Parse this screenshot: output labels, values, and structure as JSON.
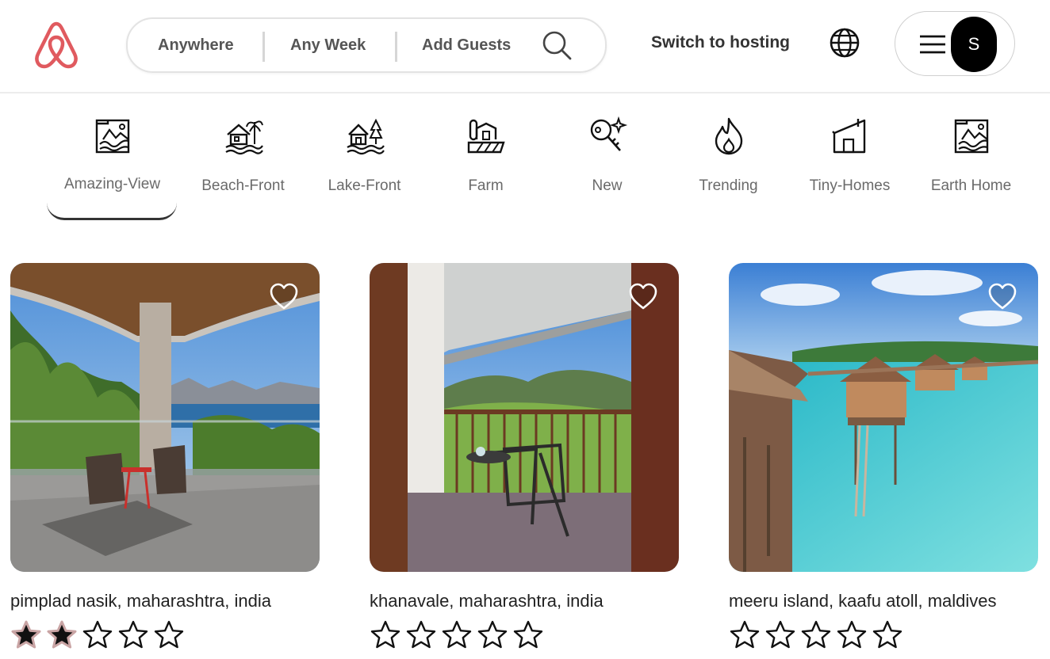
{
  "search": {
    "anywhere": "Anywhere",
    "any_week": "Any Week",
    "add_guests": "Add Guests"
  },
  "header": {
    "switch_to_hosting": "Switch to hosting",
    "avatar_initial": "S",
    "brand_color": "#e05a5f"
  },
  "categories": [
    {
      "label": "Amazing-View",
      "icon": "amazing-view-icon",
      "active": true
    },
    {
      "label": "Beach-Front",
      "icon": "beach-front-icon"
    },
    {
      "label": "Lake-Front",
      "icon": "lake-front-icon"
    },
    {
      "label": "Farm",
      "icon": "farm-icon"
    },
    {
      "label": "New",
      "icon": "new-icon"
    },
    {
      "label": "Trending",
      "icon": "trending-icon"
    },
    {
      "label": "Tiny-Homes",
      "icon": "tiny-homes-icon"
    },
    {
      "label": "Earth Home",
      "icon": "earth-home-icon"
    }
  ],
  "listings": [
    {
      "title": "pimplad nasik, maharashtra, india",
      "rating": 2,
      "max_rating": 5,
      "favorited": false
    },
    {
      "title": "khanavale, maharashtra, india",
      "rating": 0,
      "max_rating": 5,
      "favorited": false
    },
    {
      "title": "meeru island, kaafu atoll, maldives",
      "rating": 0,
      "max_rating": 5,
      "favorited": false
    }
  ]
}
